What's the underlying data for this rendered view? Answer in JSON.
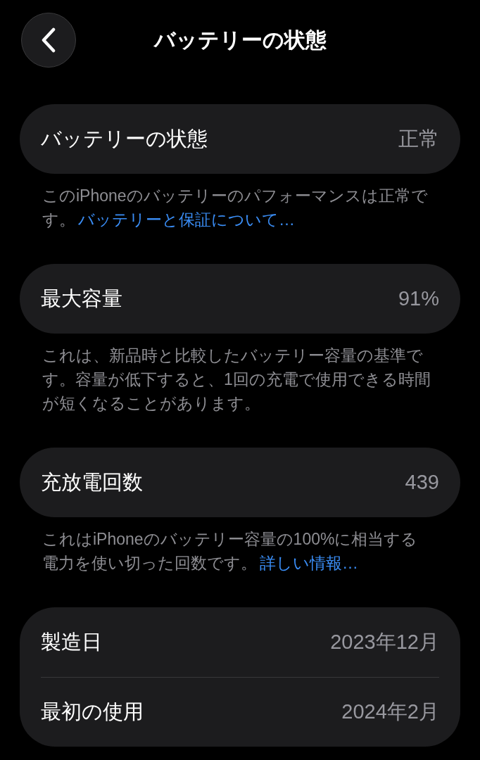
{
  "header": {
    "title": "バッテリーの状態"
  },
  "sections": [
    {
      "rows": [
        {
          "label": "バッテリーの状態",
          "value": "正常"
        }
      ],
      "footnote": {
        "text": "このiPhoneのバッテリーのパフォーマンスは正常です。",
        "link": "バッテリーと保証について…"
      }
    },
    {
      "rows": [
        {
          "label": "最大容量",
          "value": "91%"
        }
      ],
      "footnote": {
        "text": "これは、新品時と比較したバッテリー容量の基準です。容量が低下すると、1回の充電で使用できる時間が短くなることがあります。"
      }
    },
    {
      "rows": [
        {
          "label": "充放電回数",
          "value": "439"
        }
      ],
      "footnote": {
        "text": "これはiPhoneのバッテリー容量の100%に相当する電力を使い切った回数です。",
        "link": "詳しい情報…"
      }
    },
    {
      "rows": [
        {
          "label": "製造日",
          "value": "2023年12月"
        },
        {
          "label": "最初の使用",
          "value": "2024年2月"
        }
      ]
    }
  ]
}
